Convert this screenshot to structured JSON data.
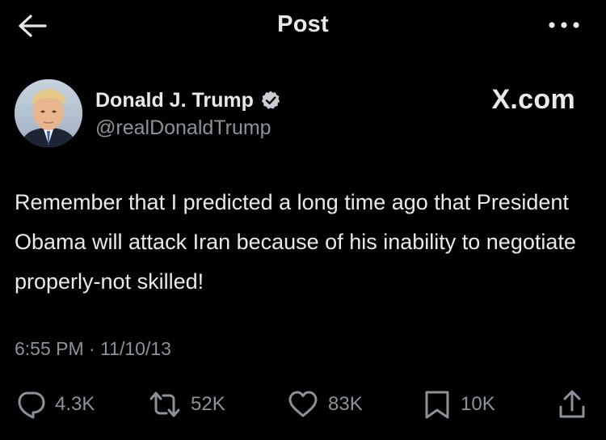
{
  "header": {
    "title": "Post",
    "back_icon": "arrow-left-icon",
    "more_icon": "more-horizontal-icon"
  },
  "author": {
    "display_name": "Donald J. Trump",
    "handle": "@realDonaldTrump",
    "verified_icon": "verified-badge-icon"
  },
  "watermark": "X.com",
  "tweet": {
    "text": "Remember that I predicted a long time ago that President Obama will attack Iran because of his inability to negotiate properly-not skilled!",
    "timestamp": "6:55 PM · 11/10/13"
  },
  "actions": {
    "replies": {
      "icon": "reply-icon",
      "count": "4.3K"
    },
    "reposts": {
      "icon": "repost-icon",
      "count": "52K"
    },
    "likes": {
      "icon": "heart-icon",
      "count": "83K"
    },
    "bookmarks": {
      "icon": "bookmark-icon",
      "count": "10K"
    },
    "share": {
      "icon": "share-icon"
    }
  },
  "colors": {
    "background": "#000000",
    "primary_text": "#e7e9ea",
    "secondary_text": "#8b9299",
    "verified_badge": "#c9ced4"
  }
}
